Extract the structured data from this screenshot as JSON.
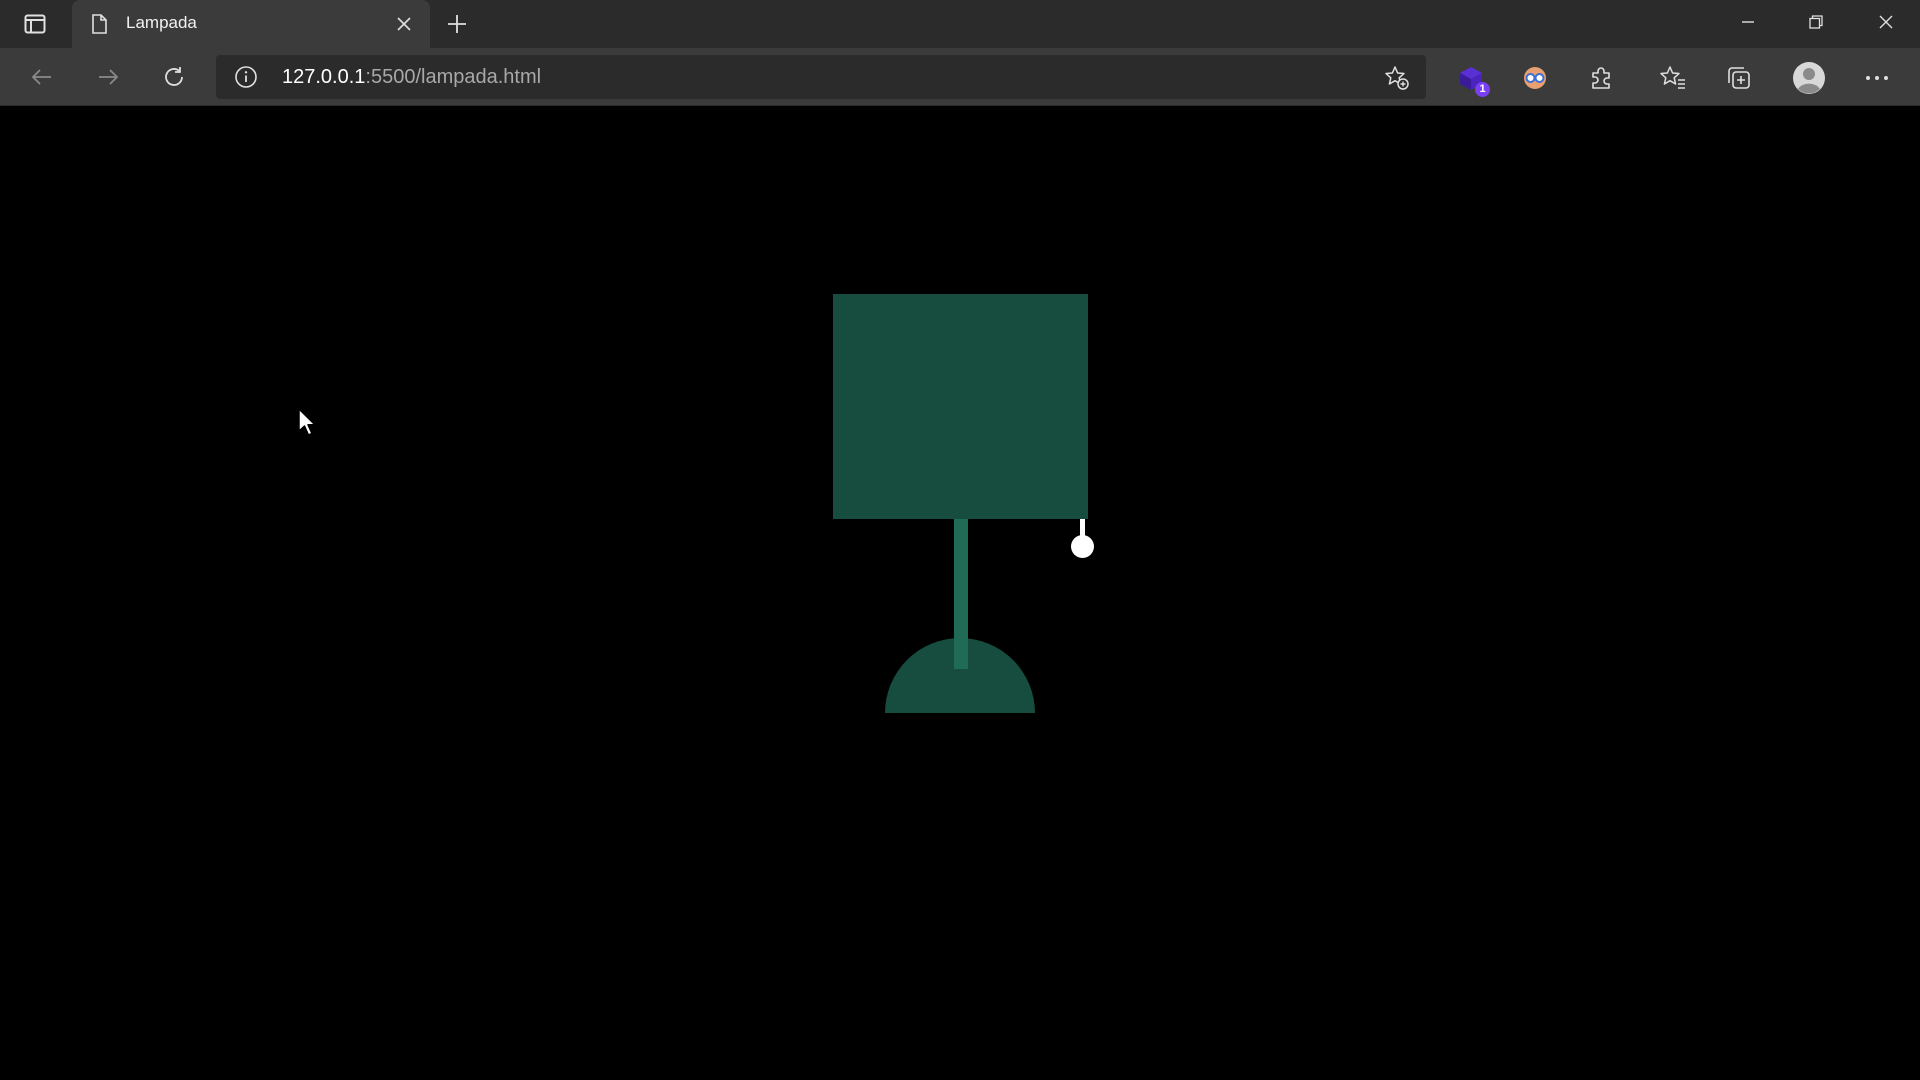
{
  "browser": {
    "tab": {
      "title": "Lampada"
    },
    "address": {
      "host": "127.0.0.1",
      "path": ":5500/lampada.html"
    },
    "extensions": [
      {
        "icon": "extension-cube-icon",
        "badge": "1"
      }
    ]
  },
  "page": {
    "lamp": {
      "shade_color": "#164d3f",
      "pole_color": "#1f6b56",
      "base_color": "#164d3f",
      "switch_color": "#ffffff",
      "state": "off"
    },
    "background_color": "#000000"
  }
}
